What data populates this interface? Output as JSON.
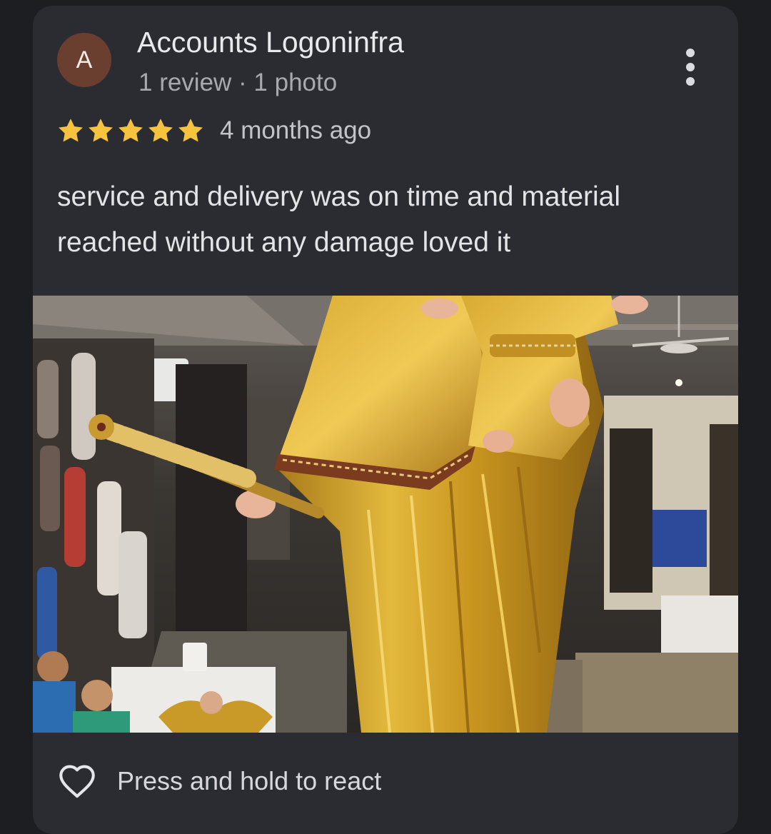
{
  "review": {
    "avatar_letter": "A",
    "author_name": "Accounts Logoninfra",
    "author_meta": "1 review · 1 photo",
    "rating": 5,
    "rating_max": 5,
    "time_ago": "4 months ago",
    "text": "service and delivery was on time and material reached without any damage loved it",
    "menu_icon": "more-vert-icon"
  },
  "footer": {
    "react_icon": "heart-outline-icon",
    "react_label": "Press and hold to react"
  },
  "colors": {
    "card_bg": "#2b2c32",
    "page_bg": "#1d1e22",
    "avatar_bg": "#6b3f30",
    "star": "#f6c33f",
    "statue_gold": "#d4a52a"
  }
}
